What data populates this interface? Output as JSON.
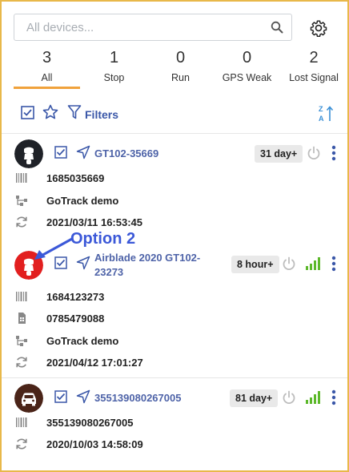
{
  "search": {
    "placeholder": "All devices..."
  },
  "tabs": [
    {
      "count": "3",
      "label": "All"
    },
    {
      "count": "1",
      "label": "Stop"
    },
    {
      "count": "0",
      "label": "Run"
    },
    {
      "count": "0",
      "label": "GPS Weak"
    },
    {
      "count": "2",
      "label": "Lost Signal"
    }
  ],
  "toolbar": {
    "filters_label": "Filters"
  },
  "devices": [
    {
      "name": "GT102-35669",
      "badge": "31 day+",
      "avatar_color": "#1f2228",
      "rows": [
        "1685035669",
        "GoTrack demo",
        "2021/03/11 16:53:45"
      ]
    },
    {
      "name_line1": "Airblade 2020 GT102-",
      "name_line2": "23273",
      "badge": "8 hour+",
      "avatar_color": "#e21f1f",
      "rows": [
        "1684123273",
        "0785479088",
        "GoTrack demo",
        "2021/04/12 17:01:27"
      ]
    },
    {
      "name": "355139080267005",
      "badge": "81 day+",
      "avatar_color": "#4a2418",
      "rows": [
        "355139080267005",
        "2020/10/03 14:58:09"
      ]
    }
  ],
  "annotation": {
    "label": "Option 2"
  },
  "colors": {
    "accent": "#f0a23b",
    "link": "#4e63a8",
    "signal": "#5cb82a",
    "power": "#bdbdbd"
  }
}
